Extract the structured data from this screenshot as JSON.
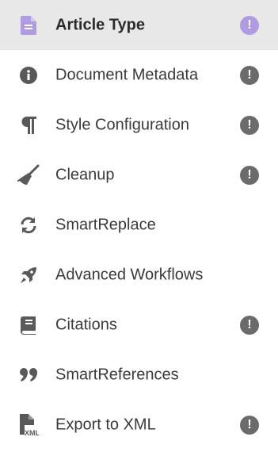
{
  "colors": {
    "active_bg": "#e8e8e8",
    "active_accent": "#b19be0",
    "icon": "#595959",
    "alert": "#6b6b6b"
  },
  "nav": {
    "items": [
      {
        "label": "Article Type",
        "icon": "document-icon",
        "active": true,
        "alert": "!"
      },
      {
        "label": "Document Metadata",
        "icon": "info-icon",
        "active": false,
        "alert": "!"
      },
      {
        "label": "Style Configuration",
        "icon": "paragraph-icon",
        "active": false,
        "alert": "!"
      },
      {
        "label": "Cleanup",
        "icon": "broom-icon",
        "active": false,
        "alert": "!"
      },
      {
        "label": "SmartReplace",
        "icon": "sync-icon",
        "active": false,
        "alert": null
      },
      {
        "label": "Advanced Workflows",
        "icon": "rocket-icon",
        "active": false,
        "alert": null
      },
      {
        "label": "Citations",
        "icon": "book-icon",
        "active": false,
        "alert": "!"
      },
      {
        "label": "SmartReferences",
        "icon": "quote-icon",
        "active": false,
        "alert": null
      },
      {
        "label": "Export to XML",
        "icon": "xml-file-icon",
        "active": false,
        "alert": "!"
      }
    ]
  }
}
